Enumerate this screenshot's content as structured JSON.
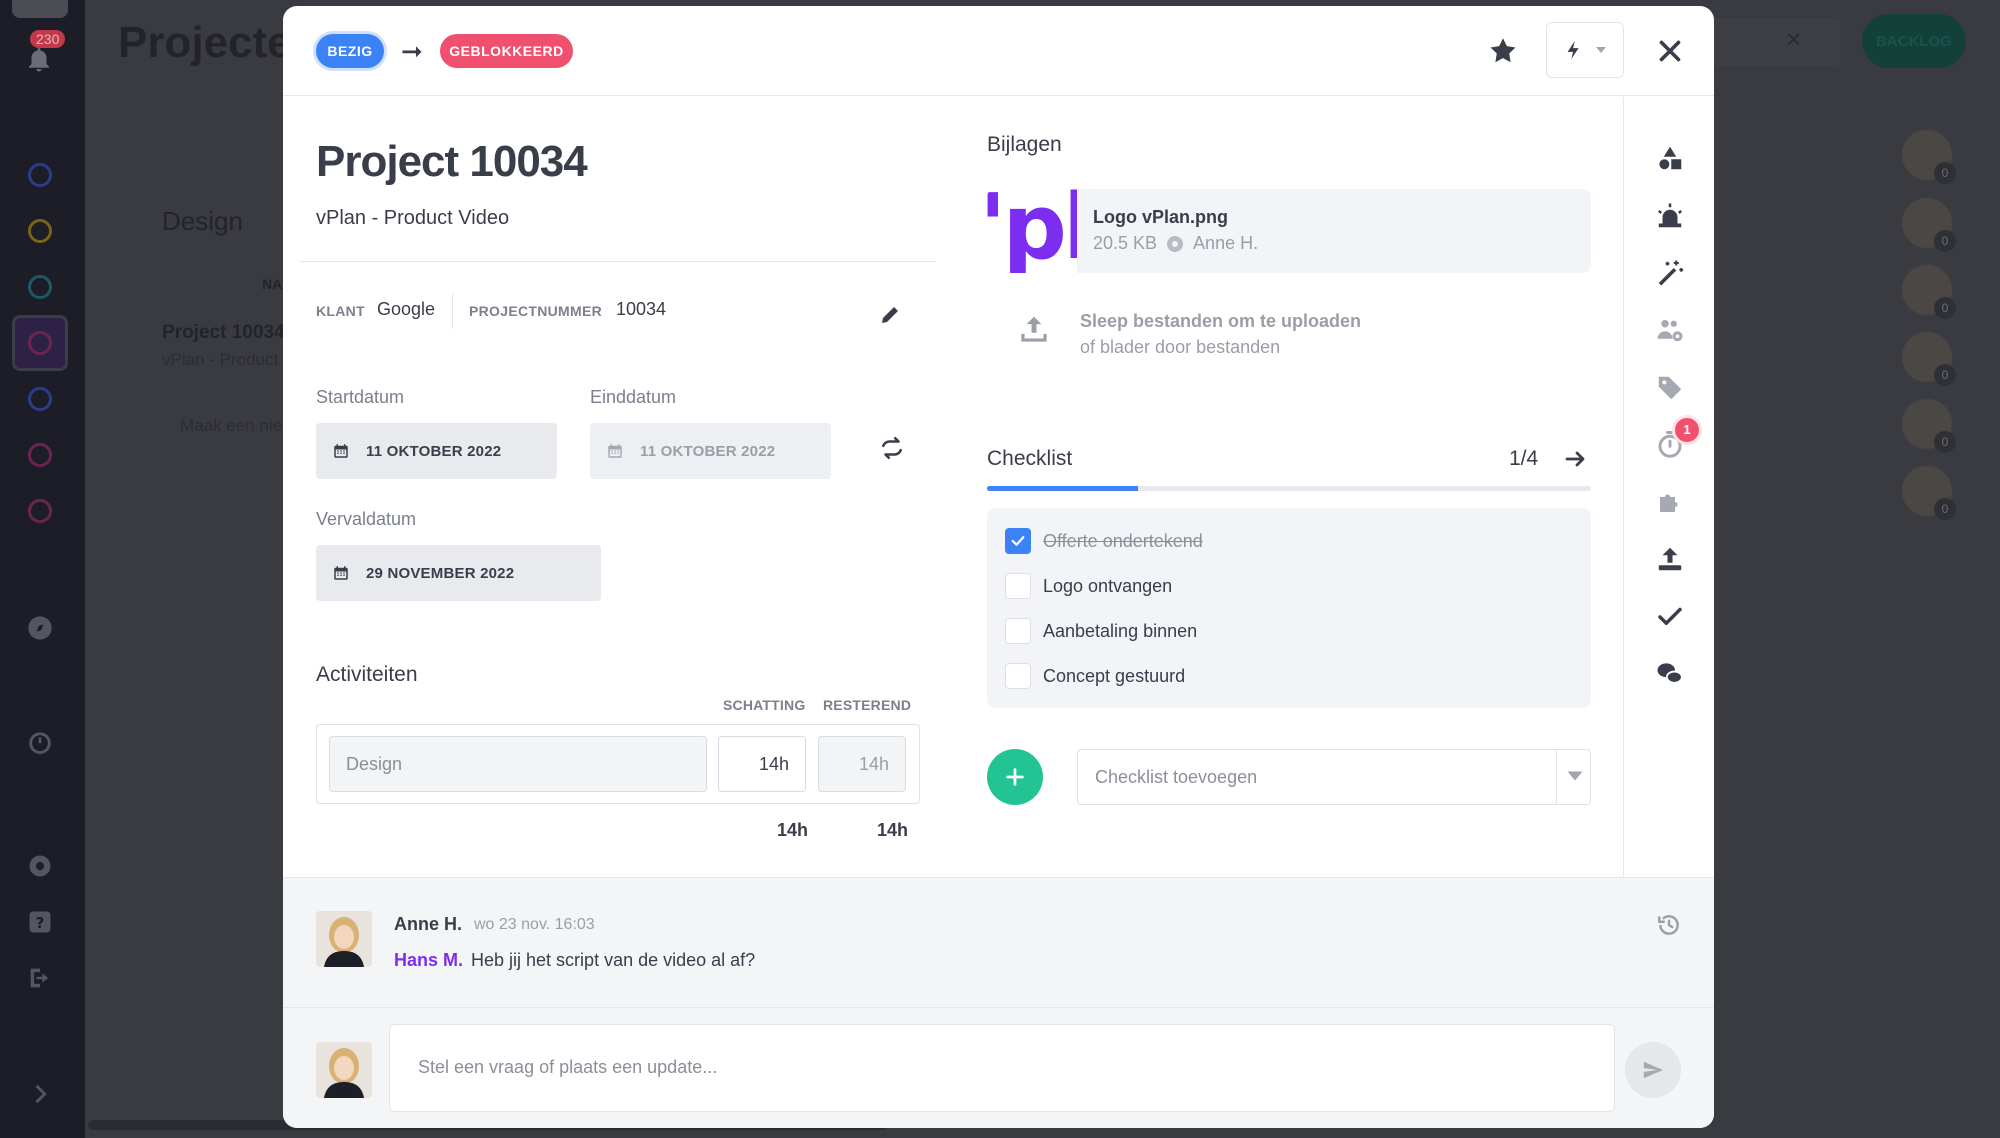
{
  "background": {
    "notification_count": "230",
    "page_title": "Projecten",
    "column_title": "Design",
    "column_header": "NA",
    "project_card_title": "Project 10034",
    "project_card_sub": "vPlan - Product Video",
    "create_placeholder": "Maak een nie",
    "backlog_label": "BACKLOG",
    "people_counts": [
      "0",
      "0",
      "0",
      "0",
      "0",
      "0"
    ]
  },
  "header": {
    "status_from": "BEZIG",
    "status_to": "GEBLOKKEERD",
    "colors": {
      "bezig": "#3b82f6",
      "geblokkeerd": "#f0506e"
    },
    "icons": [
      "star-icon",
      "bolt-icon",
      "close-icon"
    ]
  },
  "project": {
    "title": "Project 10034",
    "subtitle": "vPlan - Product Video",
    "client_label": "KLANT",
    "client_value": "Google",
    "number_label": "PROJECTNUMMER",
    "number_value": "10034"
  },
  "dates": {
    "start_label": "Startdatum",
    "start_value": "11 OKTOBER 2022",
    "end_label": "Einddatum",
    "end_value": "11 OKTOBER 2022",
    "due_label": "Vervaldatum",
    "due_value": "29 NOVEMBER 2022"
  },
  "activities": {
    "title": "Activiteiten",
    "col_estimate": "SCHATTING",
    "col_remaining": "RESTEREND",
    "rows": [
      {
        "name": "Design",
        "estimate": "14h",
        "remaining": "14h"
      }
    ],
    "total_estimate": "14h",
    "total_remaining": "14h"
  },
  "attachments": {
    "title": "Bijlagen",
    "file_name": "Logo vPlan.png",
    "file_size": "20.5 KB",
    "file_owner": "Anne H.",
    "thumb_text": "'plc",
    "upload_line1": "Sleep bestanden om te uploaden",
    "upload_line2": "of blader door bestanden"
  },
  "checklist": {
    "title": "Checklist",
    "count": "1/4",
    "progress": 0.25,
    "items": [
      {
        "label": "Offerte ondertekend",
        "done": true
      },
      {
        "label": "Logo ontvangen",
        "done": false
      },
      {
        "label": "Aanbetaling binnen",
        "done": false
      },
      {
        "label": "Concept gestuurd",
        "done": false
      }
    ],
    "add_placeholder": "Checklist toevoegen"
  },
  "sidebar_badge": "1",
  "feed": {
    "author": "Anne H.",
    "time": "wo 23 nov. 16:03",
    "mention": "Hans M.",
    "message": "Heb jij het script van de video al af?"
  },
  "composer": {
    "placeholder": "Stel een vraag of plaats een update..."
  }
}
